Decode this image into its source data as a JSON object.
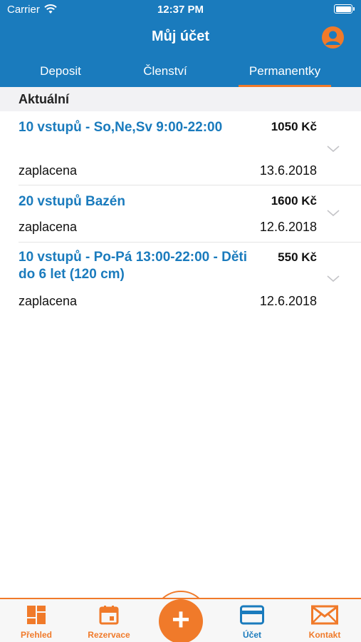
{
  "status_bar": {
    "carrier": "Carrier",
    "time": "12:37 PM"
  },
  "nav": {
    "title": "Můj účet"
  },
  "tabs": [
    {
      "label": "Deposit"
    },
    {
      "label": "Členství"
    },
    {
      "label": "Permanentky",
      "selected": true
    }
  ],
  "section": {
    "title": "Aktuální"
  },
  "items": [
    {
      "name": "10 vstupů - So,Ne,Sv 9:00-22:00",
      "price": "1050 Kč",
      "status": "zaplacena",
      "date": "13.6.2018"
    },
    {
      "name": "20 vstupů Bazén",
      "price": "1600 Kč",
      "status": "zaplacena",
      "date": "12.6.2018"
    },
    {
      "name": "10 vstupů - Po-Pá 13:00-22:00 - Děti do 6 let (120 cm)",
      "price": "550 Kč",
      "status": "zaplacena",
      "date": "12.6.2018"
    }
  ],
  "tabbar": {
    "items": [
      {
        "label": "Přehled",
        "icon": "dashboard-icon"
      },
      {
        "label": "Rezervace",
        "icon": "calendar-icon"
      },
      {
        "label": "Účet",
        "icon": "card-icon",
        "selected": true
      },
      {
        "label": "Kontakt",
        "icon": "mail-icon"
      }
    ],
    "fab": "+"
  },
  "colors": {
    "primary": "#1a7bbd",
    "accent": "#f07a2a"
  }
}
